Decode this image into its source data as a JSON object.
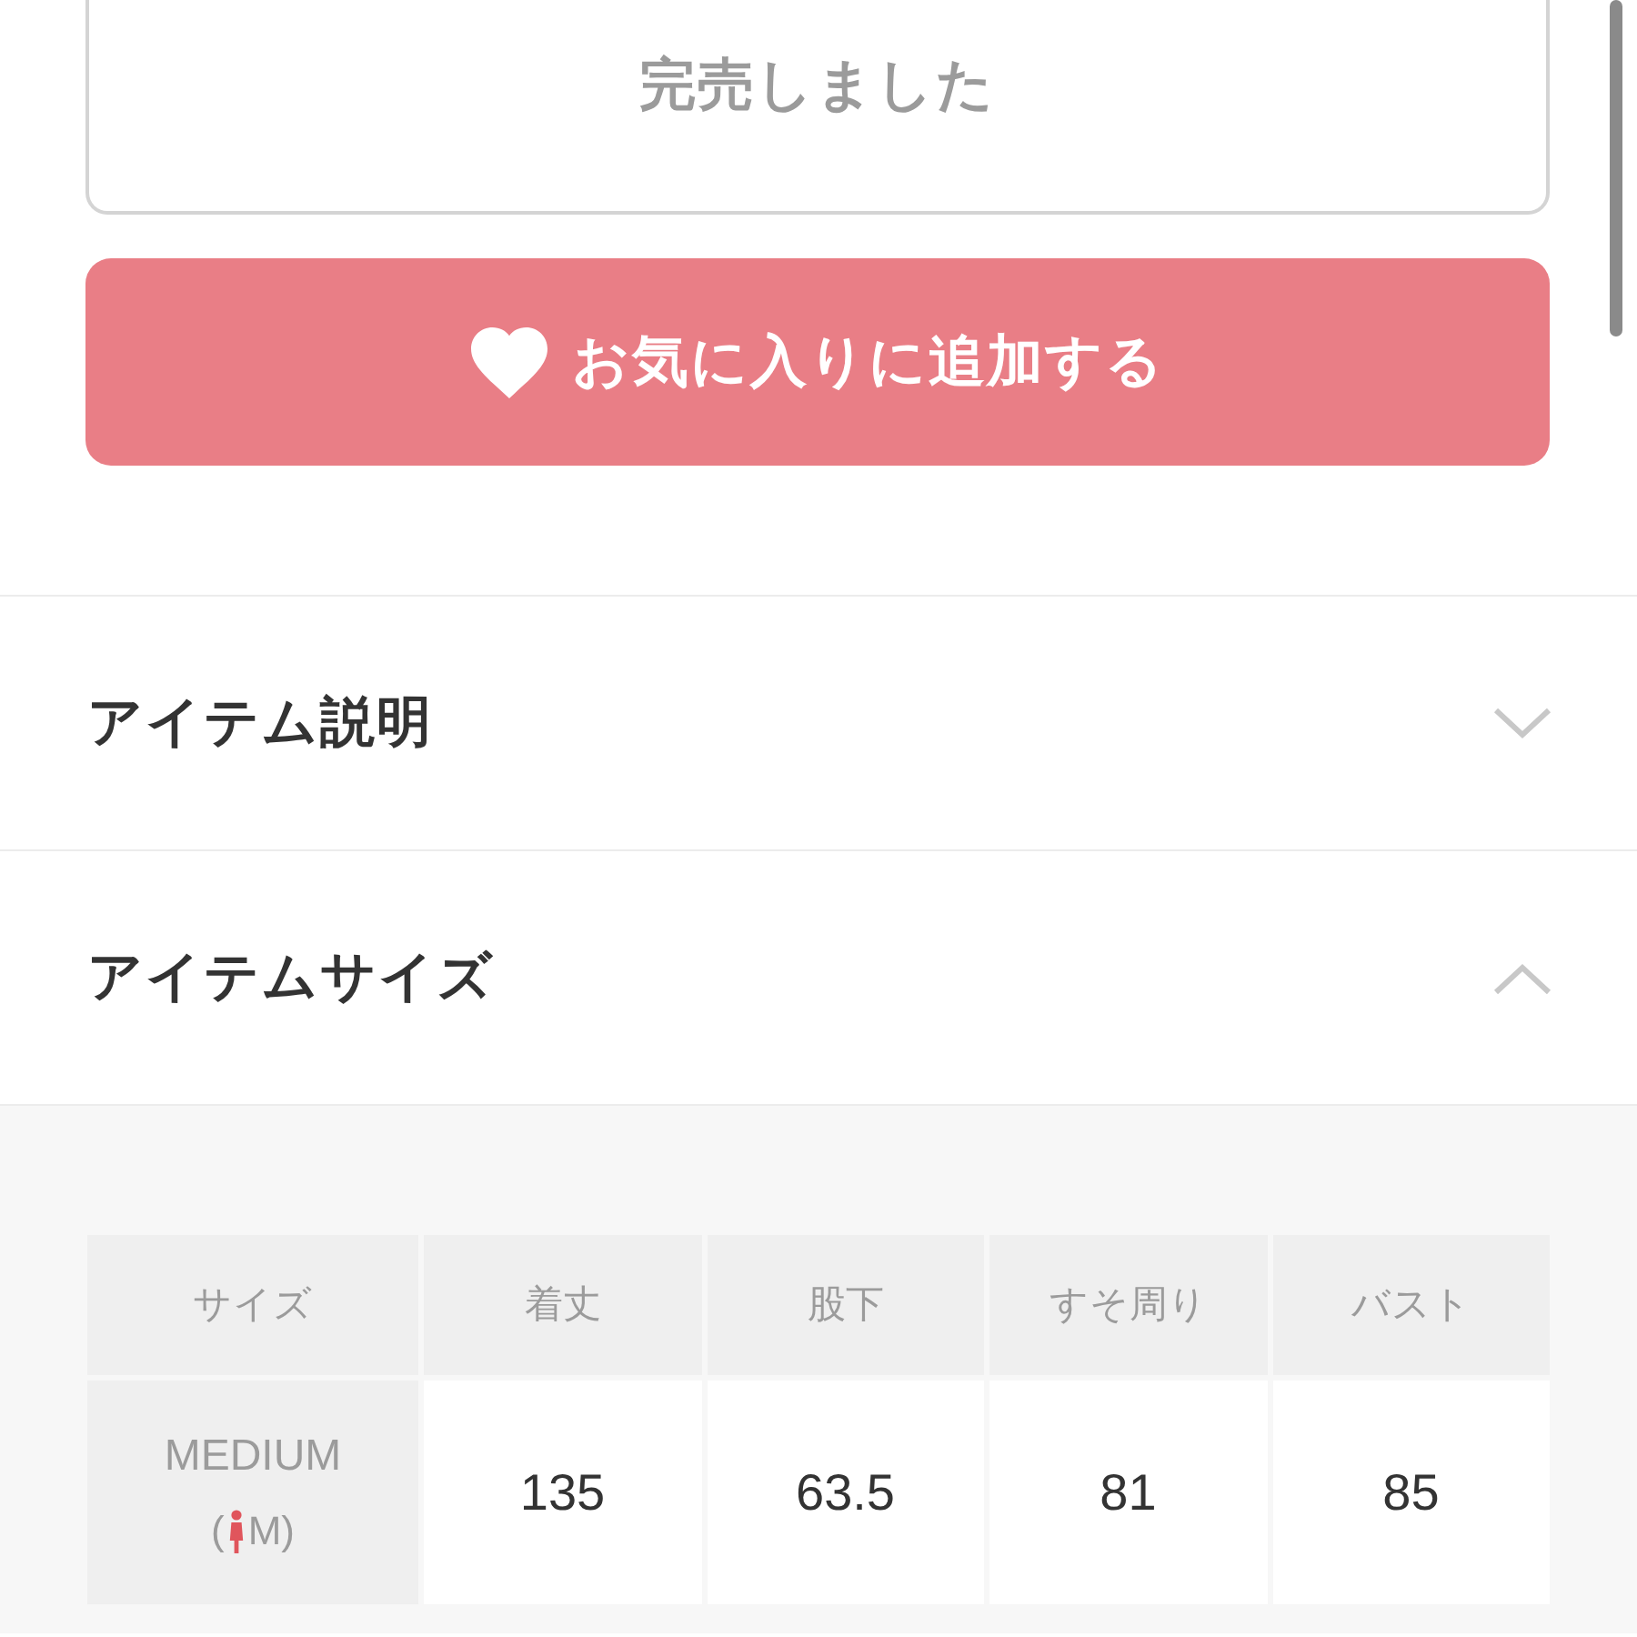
{
  "sold_out_button": {
    "label": "完売しました",
    "disabled": true
  },
  "favorite_button": {
    "label": "お気に入りに追加する"
  },
  "accordions": [
    {
      "title": "アイテム説明",
      "expanded": false
    },
    {
      "title": "アイテムサイズ",
      "expanded": true,
      "size_table": {
        "columns": [
          "サイズ",
          "着丈",
          "股下",
          "すそ周り",
          "バスト"
        ],
        "rows": [
          {
            "size": "MEDIUM",
            "note_open": "(",
            "note_close": "M)",
            "values": [
              "135",
              "63.5",
              "81",
              "85"
            ]
          }
        ]
      }
    }
  ]
}
